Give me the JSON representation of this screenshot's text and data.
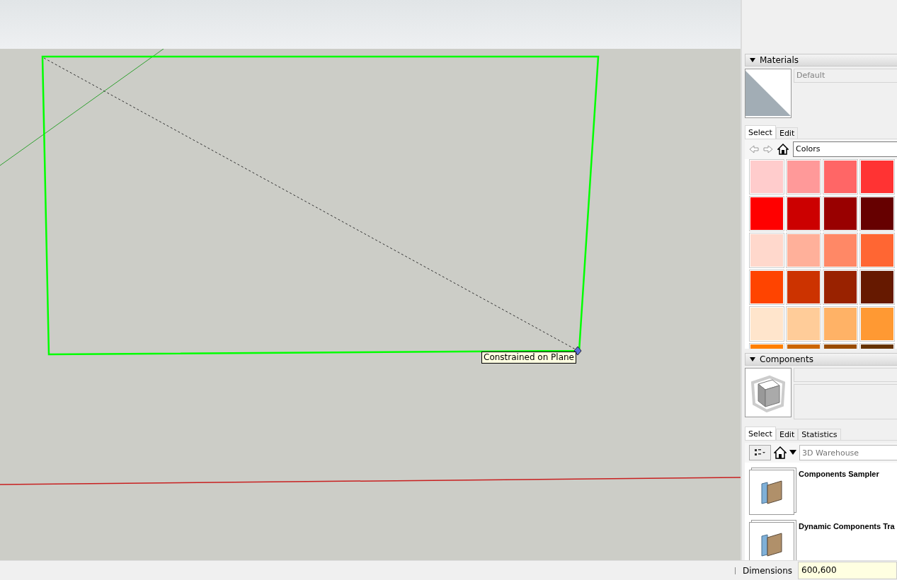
{
  "viewport": {
    "tooltip": "Constrained on Plane"
  },
  "materials": {
    "title": "Materials",
    "expanded": true,
    "name": "Default",
    "tabs": [
      {
        "label": "Select",
        "selected": true
      },
      {
        "label": "Edit",
        "selected": false
      }
    ],
    "library": "Colors",
    "swatches": [
      {
        "color": "#ffcccc"
      },
      {
        "color": "#ff9999"
      },
      {
        "color": "#ff6666"
      },
      {
        "color": "#ff3333"
      },
      {
        "color": "#ff0000"
      },
      {
        "color": "#cc0000"
      },
      {
        "color": "#990000"
      },
      {
        "color": "#660000"
      },
      {
        "color": "#ffd8cc"
      },
      {
        "color": "#ffb09a"
      },
      {
        "color": "#ff8866"
      },
      {
        "color": "#ff6633"
      },
      {
        "color": "#ff4400"
      },
      {
        "color": "#cc3300"
      },
      {
        "color": "#992200"
      },
      {
        "color": "#661900"
      },
      {
        "color": "#ffe5cc"
      },
      {
        "color": "#ffcc99"
      },
      {
        "color": "#ffb266"
      },
      {
        "color": "#ff9933"
      },
      {
        "color": "#ff8000"
      },
      {
        "color": "#cc6600"
      },
      {
        "color": "#994c00"
      },
      {
        "color": "#663300"
      }
    ]
  },
  "components": {
    "title": "Components",
    "expanded": true,
    "tabs": [
      {
        "label": "Select",
        "selected": true
      },
      {
        "label": "Edit",
        "selected": false
      },
      {
        "label": "Statistics",
        "selected": false
      }
    ],
    "search": {
      "placeholder": "3D Warehouse"
    },
    "items": [
      {
        "name": "Components Sampler"
      },
      {
        "name": "Dynamic Components Tra"
      }
    ]
  },
  "status_bar": {
    "label": "Dimensions",
    "value": "600,600"
  }
}
